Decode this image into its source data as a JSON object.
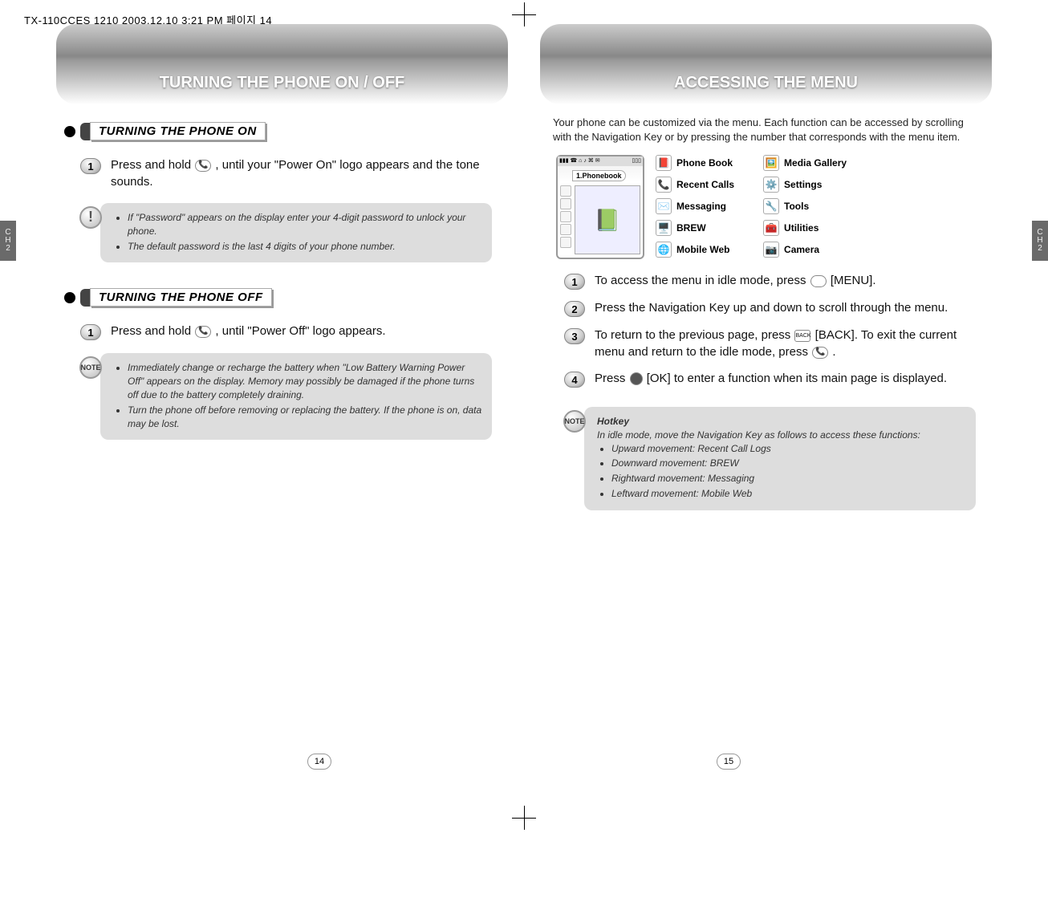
{
  "headerLine": "TX-110CCES 1210  2003.12.10 3:21 PM  페이지 14",
  "chapterLabel": {
    "c": "C",
    "h": "H",
    "n": "2"
  },
  "pageNumbers": {
    "left": "14",
    "right": "15"
  },
  "leftPage": {
    "title": "TURNING THE PHONE ON / OFF",
    "sectionOn": {
      "heading": "TURNING THE PHONE ON",
      "step1_a": "Press and hold ",
      "step1_b": " , until your \"Power On\" logo appears and the tone sounds.",
      "note": {
        "items": [
          "If \"Password\" appears on the display enter your 4-digit password to unlock your phone.",
          "The default password is the last 4 digits of your phone number."
        ]
      }
    },
    "sectionOff": {
      "heading": "TURNING THE PHONE OFF",
      "step1_a": "Press and hold ",
      "step1_b": " , until \"Power Off\" logo appears.",
      "note": {
        "badge": "NOTE",
        "items": [
          "Immediately change or recharge the battery when \"Low Battery Warning Power Off\" appears on the display. Memory may possibly be damaged if the phone turns off due to the battery completely draining.",
          "Turn the phone off before removing or replacing the battery. If the phone is on, data may be lost."
        ]
      }
    }
  },
  "rightPage": {
    "title": "ACCESSING THE MENU",
    "intro": "Your phone can be customized via the menu. Each function can be accessed by scrolling with the Navigation Key or by pressing the number that corresponds with the menu item.",
    "screenTab": "1.Phonebook",
    "screenBar": {
      "l": "▮▮▮ ☎ ⌂ ♪ ⌘ ✉",
      "r": "▯▯▯"
    },
    "menuCol1": [
      {
        "icon": "📕",
        "label": "Phone Book"
      },
      {
        "icon": "📞",
        "label": "Recent Calls"
      },
      {
        "icon": "✉️",
        "label": "Messaging"
      },
      {
        "icon": "🖥️",
        "label": "BREW"
      },
      {
        "icon": "🌐",
        "label": "Mobile Web"
      }
    ],
    "menuCol2": [
      {
        "icon": "🖼️",
        "label": "Media Gallery"
      },
      {
        "icon": "⚙️",
        "label": "Settings"
      },
      {
        "icon": "🔧",
        "label": "Tools"
      },
      {
        "icon": "🧰",
        "label": "Utilities"
      },
      {
        "icon": "📷",
        "label": "Camera"
      }
    ],
    "step1_a": "To access the menu in idle mode, press ",
    "step1_b": " [MENU].",
    "step2": "Press the Navigation Key up and down to scroll through the menu.",
    "step3_a": "To return to the previous page, press ",
    "step3_b": " [BACK]. To exit the current menu and return to the idle mode, press ",
    "step3_c": " .",
    "step4_a": "Press ",
    "step4_b": " [OK] to enter a function when its main page is displayed.",
    "note": {
      "badge": "NOTE",
      "title": "Hotkey",
      "intro": "In idle mode, move the Navigation Key as follows to access these functions:",
      "items": [
        "Upward movement: Recent Call Logs",
        "Downward movement: BREW",
        "Rightward movement: Messaging",
        "Leftward movement: Mobile Web"
      ]
    }
  }
}
